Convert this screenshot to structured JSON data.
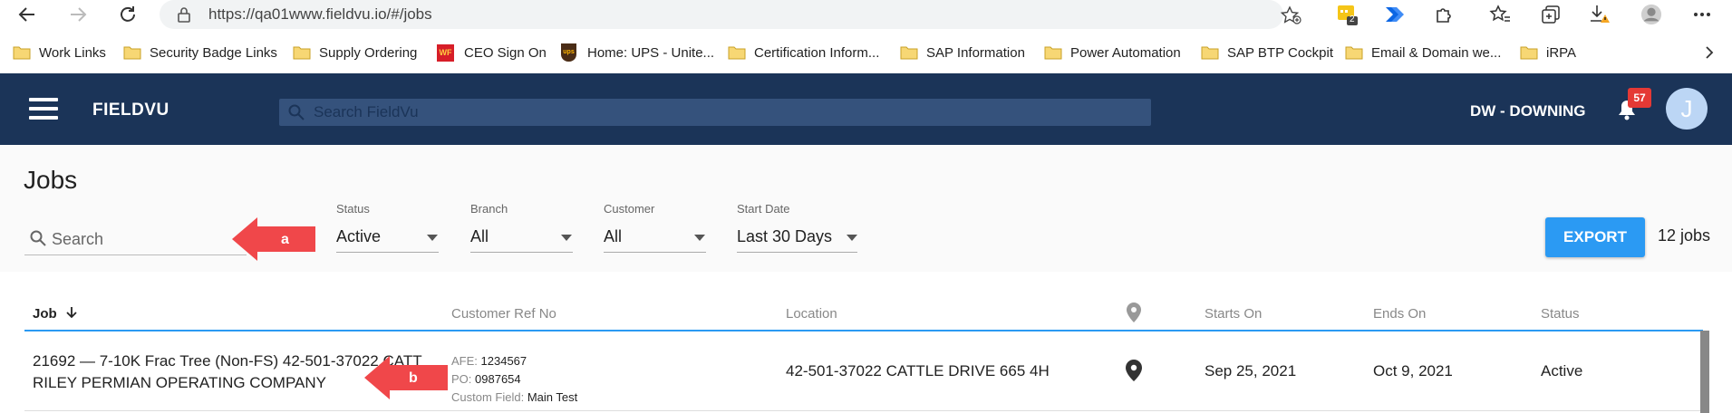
{
  "browser": {
    "url": "https://qa01www.fieldvu.io/#/jobs",
    "extension_badge": "2",
    "bookmarks": [
      {
        "label": "Work Links",
        "icon": "folder-icon"
      },
      {
        "label": "Security Badge Links",
        "icon": "folder-icon"
      },
      {
        "label": "Supply Ordering",
        "icon": "folder-icon"
      },
      {
        "label": "CEO Sign On",
        "icon": "wf-logo-icon"
      },
      {
        "label": "Home: UPS - Unite...",
        "icon": "ups-logo-icon"
      },
      {
        "label": "Certification Inform...",
        "icon": "folder-icon"
      },
      {
        "label": "SAP Information",
        "icon": "folder-icon"
      },
      {
        "label": "Power Automation",
        "icon": "folder-icon"
      },
      {
        "label": "SAP BTP Cockpit",
        "icon": "folder-icon"
      },
      {
        "label": "Email & Domain we...",
        "icon": "folder-icon"
      },
      {
        "label": "iRPA",
        "icon": "folder-icon"
      }
    ],
    "wf_logo_text": "WF",
    "ups_logo_text": "ups"
  },
  "header": {
    "brand": "FIELDVU",
    "search_placeholder": "Search FieldVu",
    "user_label": "DW - DOWNING",
    "notification_count": "57",
    "avatar_initial": "J"
  },
  "filters": {
    "page_title": "Jobs",
    "search_placeholder": "Search",
    "status": {
      "label": "Status",
      "value": "Active"
    },
    "branch": {
      "label": "Branch",
      "value": "All"
    },
    "customer": {
      "label": "Customer",
      "value": "All"
    },
    "start_date": {
      "label": "Start Date",
      "value": "Last 30 Days"
    },
    "export_label": "EXPORT",
    "job_count": "12 jobs"
  },
  "table": {
    "headers": {
      "job": "Job",
      "customer_ref": "Customer Ref No",
      "location": "Location",
      "starts_on": "Starts On",
      "ends_on": "Ends On",
      "status": "Status"
    },
    "rows": [
      {
        "job_line1": "21692 — 7-10K Frac Tree (Non-FS) 42-501-37022 CATT",
        "job_line2": "RILEY PERMIAN OPERATING COMPANY",
        "afe_label": "AFE:",
        "afe_value": "1234567",
        "po_label": "PO:",
        "po_value": "0987654",
        "custom_label": "Custom Field:",
        "custom_value": "Main Test",
        "location": "42-501-37022 CATTLE DRIVE 665 4H",
        "starts_on": "Sep 25, 2021",
        "ends_on": "Oct 9, 2021",
        "status": "Active"
      }
    ]
  },
  "annotations": {
    "arrow_a": "a",
    "arrow_b": "b",
    "color": "#f0474a"
  }
}
